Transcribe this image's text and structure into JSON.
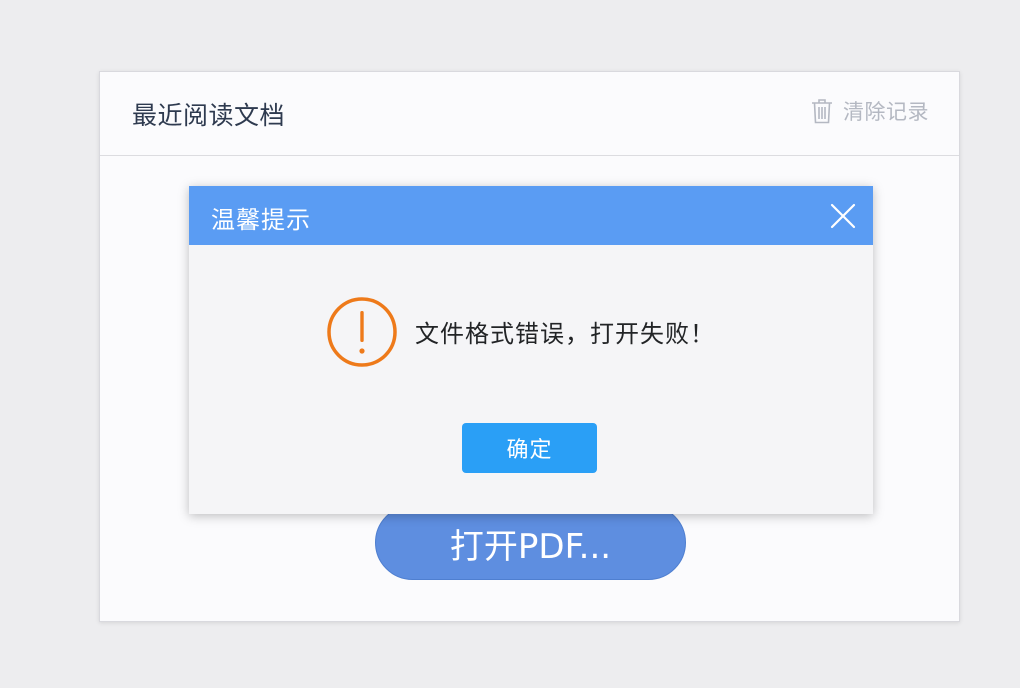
{
  "panel": {
    "title": "最近阅读文档",
    "clear_label": "清除记录",
    "clear_icon": "trash-icon"
  },
  "open_pdf_label": "打开PDF...",
  "dialog": {
    "title": "温馨提示",
    "message": "文件格式错误，打开失败！",
    "confirm_label": "确定",
    "close_icon": "close-icon",
    "warning_icon": "warning-icon"
  },
  "colors": {
    "dialog_header": "#5a9cf3",
    "confirm_button": "#2a9ff6",
    "open_pdf_button": "#5e8ee0",
    "warning": "#ee7a1a"
  }
}
